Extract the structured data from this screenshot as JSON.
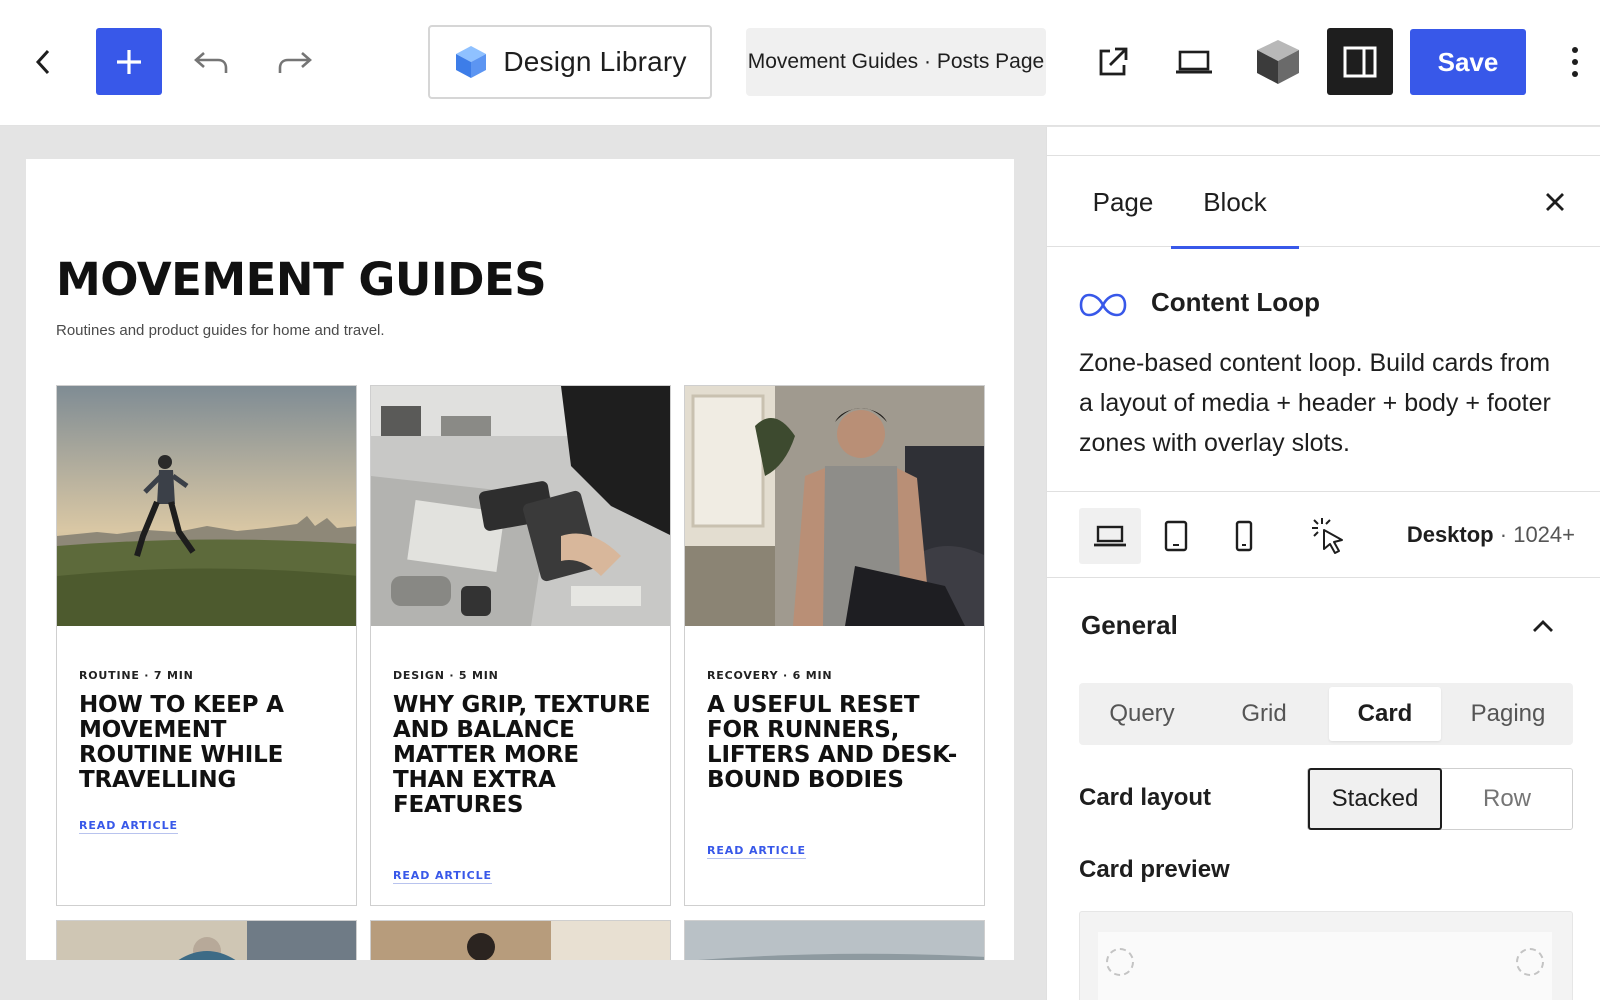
{
  "toolbar": {
    "back_icon": "chevron-left-icon",
    "add_icon": "plus-icon",
    "undo_icon": "undo-icon",
    "redo_icon": "redo-icon",
    "library_label": "Design Library",
    "library_icon": "cube-icon",
    "document_title": "Movement Guides · Posts Page",
    "external_icon": "external-link-icon",
    "preview_icon": "laptop-icon",
    "cube_icon": "cube-icon",
    "sidebar_icon": "sidebar-icon",
    "save_label": "Save",
    "more_icon": "more-vertical-icon",
    "accent_color": "#3858e9"
  },
  "canvas": {
    "title": "MOVEMENT GUIDES",
    "subtitle": "Routines and product guides for home and travel.",
    "cards": [
      {
        "meta": "ROUTINE · 7 MIN",
        "title": "HOW TO KEEP A MOVEMENT ROUTINE WHILE TRAVELLING",
        "link": "READ ARTICLE"
      },
      {
        "meta": "DESIGN · 5 MIN",
        "title": "WHY GRIP, TEXTURE AND BALANCE MATTER MORE THAN EXTRA FEATURES",
        "link": "READ ARTICLE"
      },
      {
        "meta": "RECOVERY · 6 MIN",
        "title": "A USEFUL RESET FOR RUNNERS, LIFTERS AND DESK-BOUND BODIES",
        "link": "READ ARTICLE"
      }
    ]
  },
  "sidebar": {
    "tabs": {
      "page": "Page",
      "block": "Block"
    },
    "close_icon": "close-icon",
    "block": {
      "icon": "infinity-loop-icon",
      "name": "Content Loop",
      "description": "Zone-based content loop. Build cards from a layout of media + header + body + footer zones with overlay slots."
    },
    "device": {
      "active": "Desktop",
      "separator": "·",
      "range": "1024+",
      "icons": [
        "desktop-icon",
        "tablet-icon",
        "mobile-icon",
        "hover-pointer-icon"
      ]
    },
    "general": {
      "title": "General",
      "collapse_icon": "chevron-up-icon",
      "tabs": [
        "Query",
        "Grid",
        "Card",
        "Paging"
      ],
      "active_tab": "Card",
      "card_layout_label": "Card layout",
      "card_layout_options": [
        "Stacked",
        "Row"
      ],
      "card_layout_selected": "Stacked",
      "card_preview_label": "Card preview"
    }
  }
}
